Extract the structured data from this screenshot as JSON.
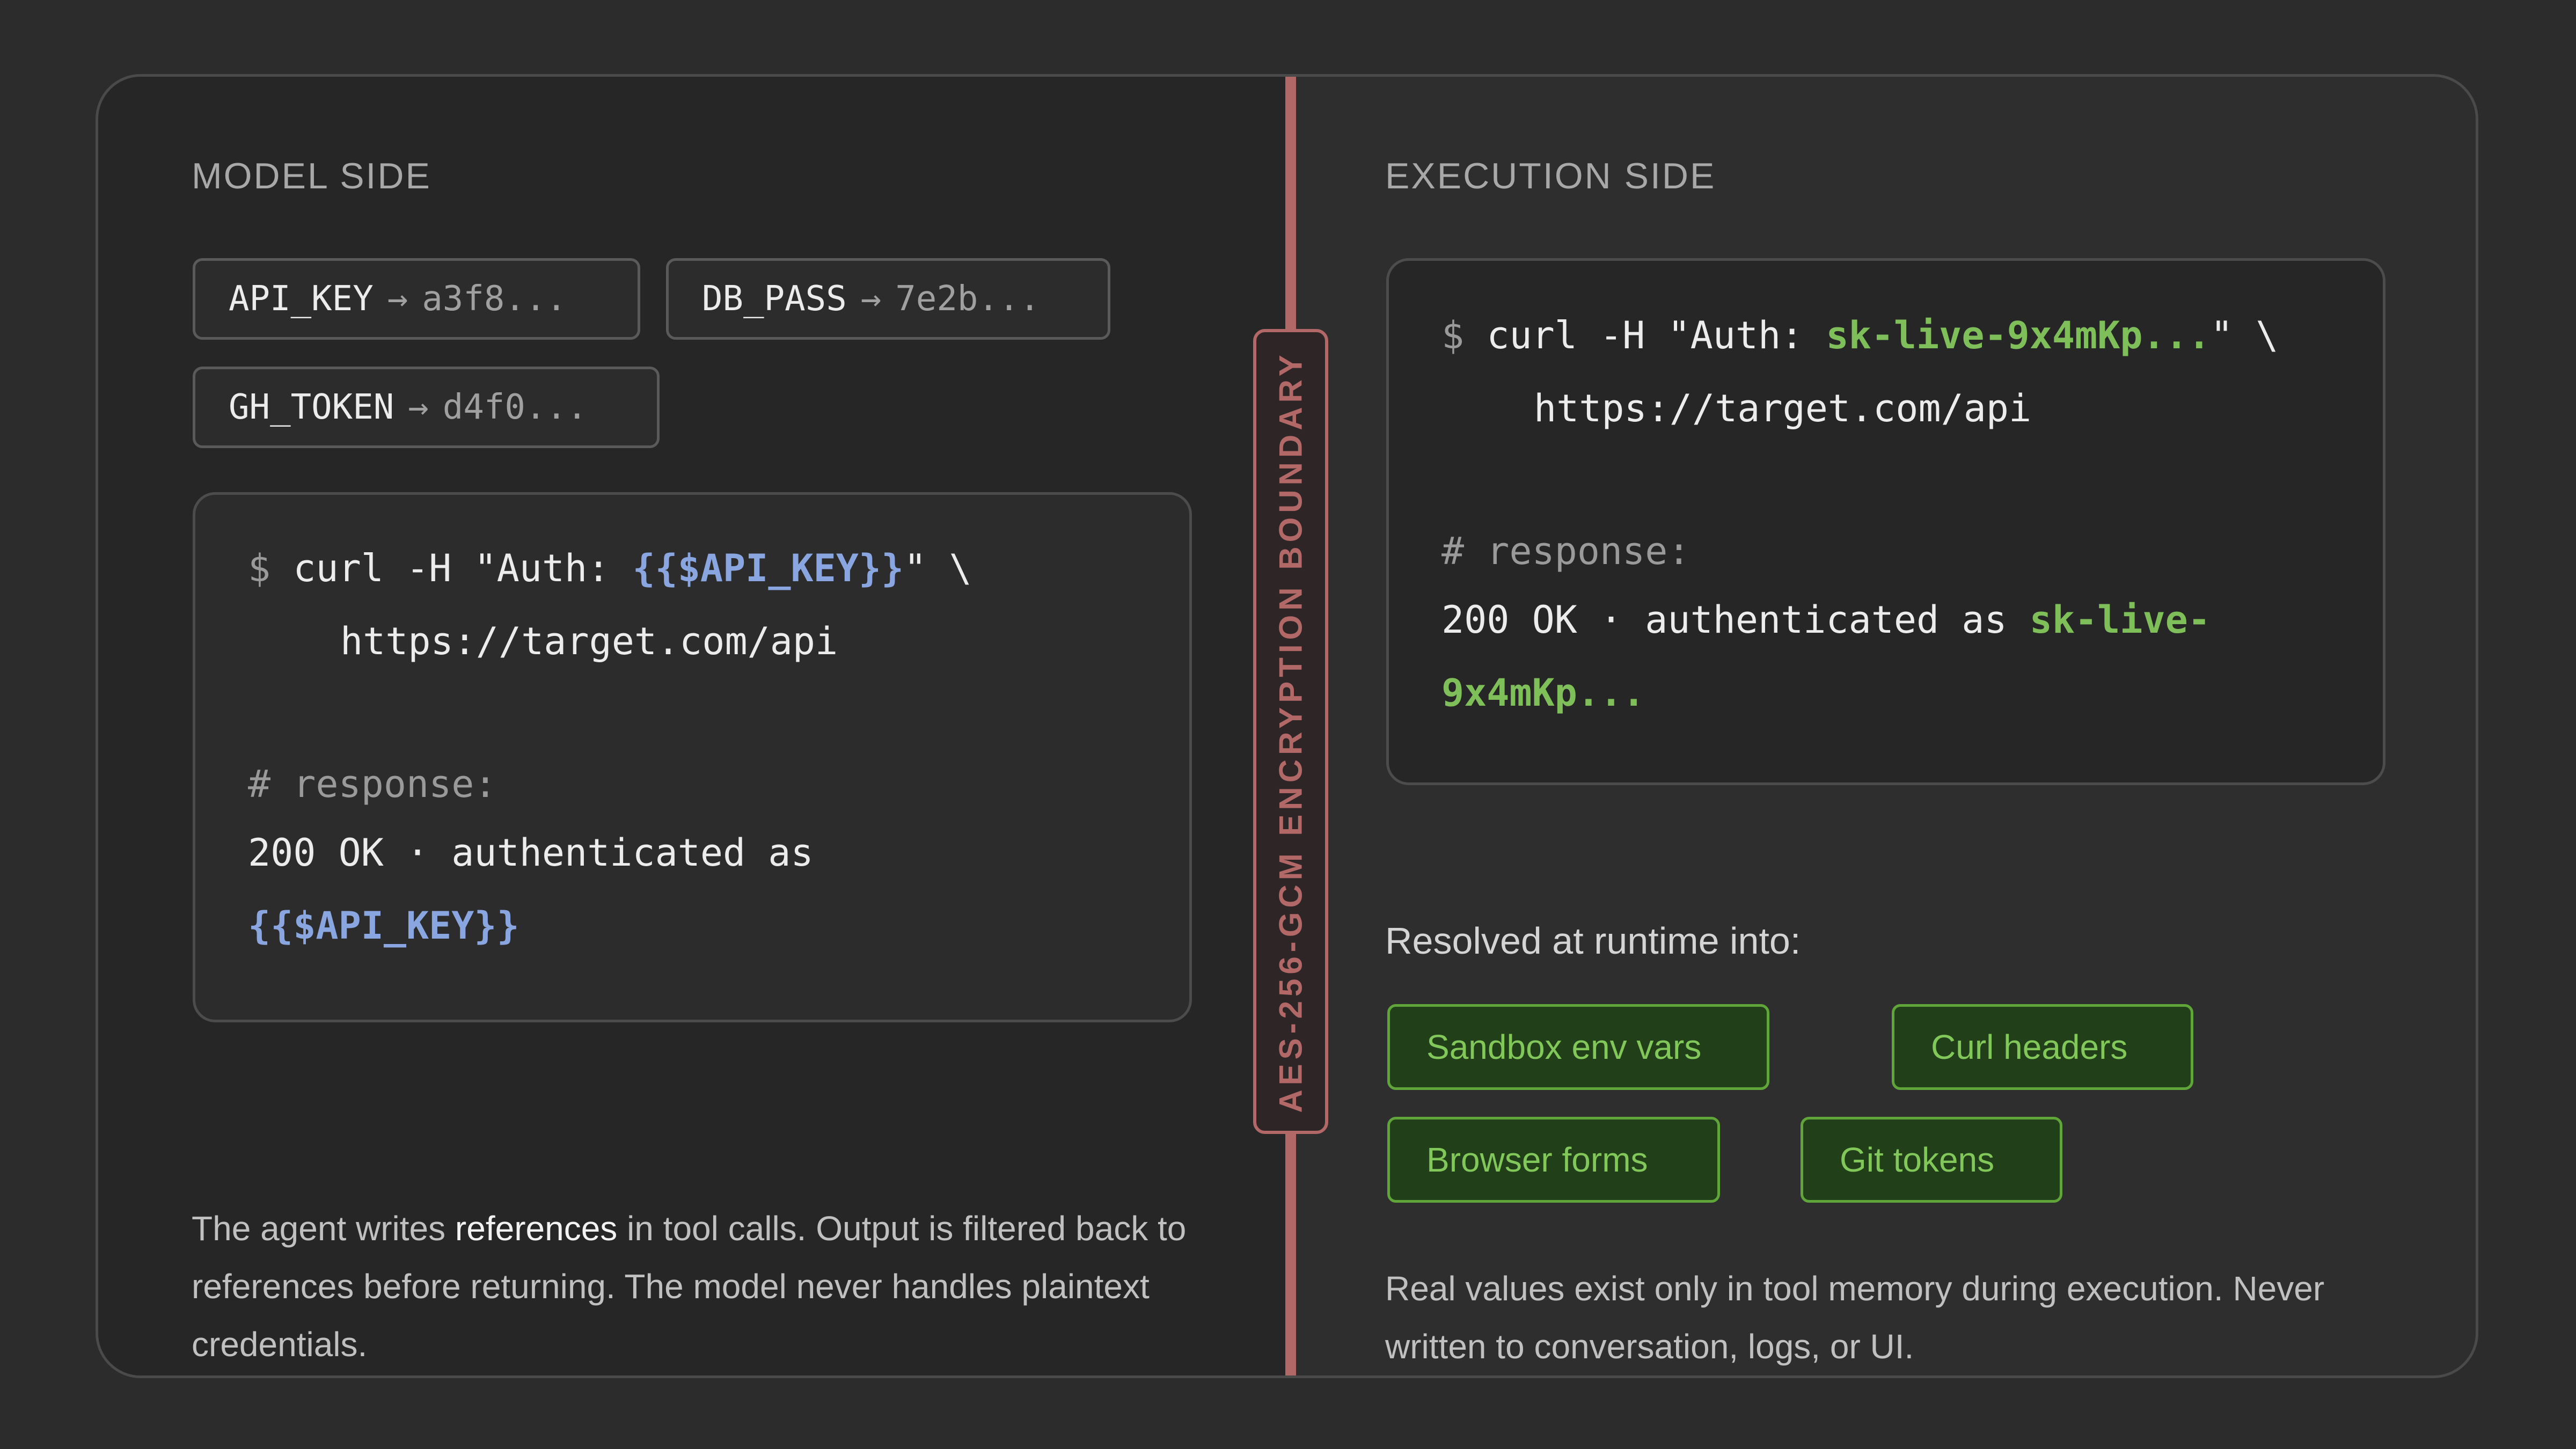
{
  "model_side": {
    "title": "MODEL SIDE",
    "chips": [
      {
        "key": "API_KEY",
        "arrow": "→",
        "value": "a3f8..."
      },
      {
        "key": "DB_PASS",
        "arrow": "→",
        "value": "7e2b..."
      },
      {
        "key": "GH_TOKEN",
        "arrow": "→",
        "value": "d4f0..."
      }
    ],
    "code": {
      "prompt": "$",
      "line1_pre": "curl -H \"Auth: ",
      "line1_ref": "{{$API_KEY}}",
      "line1_post": "\" \\",
      "line2": "https://target.com/api",
      "comment": "# response:",
      "line4": "200 OK · authenticated as",
      "line5_ref": "{{$API_KEY}}"
    },
    "desc_pre": "The agent writes ",
    "desc_bold": "references",
    "desc_post": " in tool calls. Output is filtered back to references before returning. The model never handles plaintext credentials."
  },
  "boundary": {
    "label": "AES-256-GCM ENCRYPTION BOUNDARY"
  },
  "execution_side": {
    "title": "EXECUTION SIDE",
    "code": {
      "prompt": "$",
      "line1_pre": "curl -H \"Auth: ",
      "line1_secret": "sk-live-9x4mKp...",
      "line1_post": "\" \\",
      "line2": "https://target.com/api",
      "comment": "# response:",
      "line4_pre": "200 OK · authenticated as ",
      "line4_secret": "sk-live-",
      "line5_secret": "9x4mKp..."
    },
    "resolved_label": "Resolved at runtime into:",
    "tags": [
      "Sandbox env vars",
      "Curl headers",
      "Browser forms",
      "Git tokens"
    ],
    "desc": "Real values exist only in tool memory during execution. Never written to conversation, logs, or UI."
  },
  "colors": {
    "background": "#2c2c2c",
    "boundary": "#b36868",
    "reference": "#8aa6e0",
    "secret": "#7fbf5a",
    "tag_border": "#5fa53a",
    "tag_fill": "#213f18"
  }
}
